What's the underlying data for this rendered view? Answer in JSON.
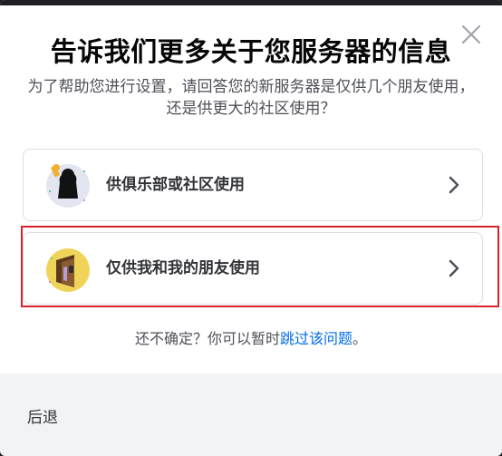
{
  "modal": {
    "title": "告诉我们更多关于您服务器的信息",
    "subtitle": "为了帮助您进行设置，请回答您的新服务器是仅供几个朋友使用，还是供更大的社区使用？",
    "close_icon": "close-icon"
  },
  "options": [
    {
      "label": "供俱乐部或社区使用",
      "icon": "club-community-icon"
    },
    {
      "label": "仅供我和我的朋友使用",
      "icon": "friends-door-icon"
    }
  ],
  "unsure": {
    "prefix": "还不确定？你可以暂时",
    "link": "跳过该问题",
    "suffix": "。"
  },
  "footer": {
    "back_label": "后退"
  },
  "colors": {
    "link": "#006ce7",
    "highlight": "#d8232a",
    "footer_bg": "#f2f3f5"
  }
}
